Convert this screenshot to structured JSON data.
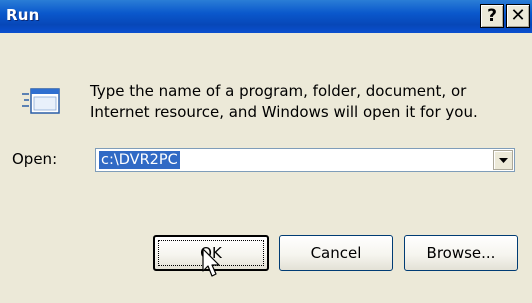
{
  "window": {
    "title": "Run",
    "help_glyph": "?",
    "close_glyph": "✕"
  },
  "dialog": {
    "icon": "run-icon",
    "description": "Type the name of a program, folder, document, or Internet resource, and Windows will open it for you.",
    "open_label": "Open:",
    "open_value": "c:\\DVR2PC",
    "open_value_selected": true
  },
  "buttons": {
    "ok": "OK",
    "cancel": "Cancel",
    "browse": "Browse..."
  },
  "colors": {
    "title_bar": "#0a58cc",
    "dialog_background": "#ece9d8",
    "selection": "#316ac5"
  }
}
